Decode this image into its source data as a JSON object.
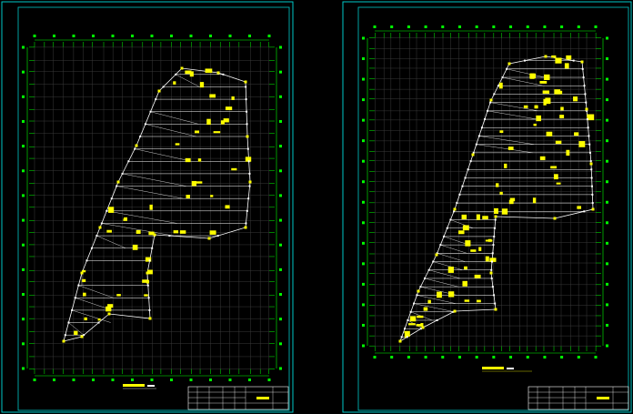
{
  "sheets": [
    {
      "title": "",
      "scale": ""
    },
    {
      "title": "",
      "scale": ""
    }
  ],
  "colors": {
    "background": "#000000",
    "frame": "#00c8c8",
    "grid": "#00ff00",
    "structure": "#ffffff",
    "annotation": "#ffff00",
    "grid_faint": "#3a3a3a"
  }
}
